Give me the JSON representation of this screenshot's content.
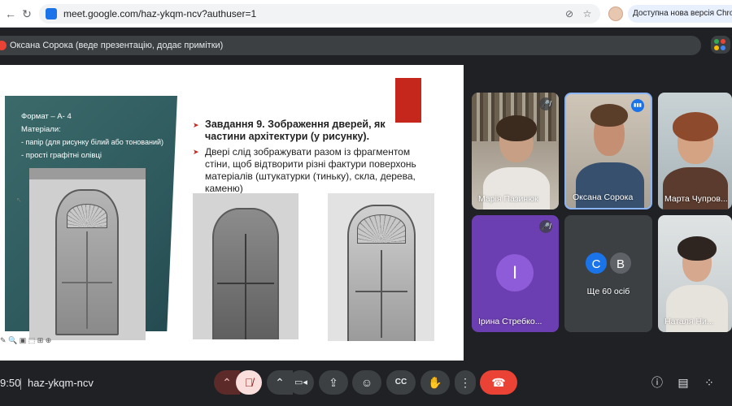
{
  "browser": {
    "back_icon": "←",
    "forward_icon": "→",
    "reload_icon": "↻",
    "url": "meet.google.com/haz-ykqm-ncv?authuser=1",
    "eye_off_icon": "⊘",
    "star_icon": "☆",
    "update_text": "Доступна нова версія Chrome"
  },
  "presenting": {
    "text": "Оксана Сорока (веде презентацію, додає примітки)"
  },
  "slide": {
    "left_lines": [
      "Формат – А- 4",
      "Матеріали:",
      "- папір (для рисунку білий або тонований)",
      "- прості графітні олівці"
    ],
    "bullet": "➤",
    "task_title": "Завдання 9. Зображення дверей, як частини архітектури (у рисунку).",
    "task_body": "Двері слід зображувати разом із фрагментом стіни, щоб відтворити різні фактури поверхонь матеріалів (штукатурки (тиньку), скла, дерева, каменю)",
    "tools": "✎ 🔍 ▣ ⬚ ⊞ ⊕",
    "cursor_mark": "↖"
  },
  "participants": [
    {
      "name": "Марія Пазинюк",
      "muted_icon": "🎤̸"
    },
    {
      "name": "Оксана Сорока",
      "speaking_icon": "▮▮▮"
    },
    {
      "name": "Марта Чупров..."
    },
    {
      "name": "Ірина Стребко...",
      "initial": "I",
      "muted_icon": "🎤̸"
    },
    {
      "name": "Ще 60 осіб",
      "initials": [
        "C",
        "B"
      ]
    },
    {
      "name": "Наталя Ни..."
    }
  ],
  "bottombar": {
    "time": "9:50",
    "code": "haz-ykqm-ncv",
    "chevron_up": "⌃",
    "mic_off_icon": "🎙̸",
    "camera_icon": "▭◂",
    "present_icon": "⇪",
    "emoji_icon": "☺",
    "captions_icon": "CC",
    "hand_icon": "✋",
    "more_icon": "⋮",
    "hangup_icon": "☎",
    "info_icon": "ⓘ",
    "chat_icon": "▤",
    "activities_icon": "⁘"
  },
  "colors": {
    "accent_red": "#ea4335",
    "meet_bg": "#202124",
    "tile_purple": "#6b3fb1",
    "slide_teal": "#2e5a5e",
    "slide_red": "#c5271d"
  }
}
